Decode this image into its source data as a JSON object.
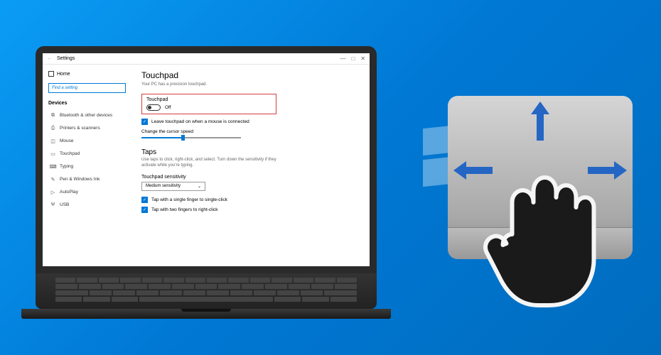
{
  "window": {
    "title": "Settings",
    "home": "Home",
    "search_placeholder": "Find a setting"
  },
  "sidebar": {
    "section": "Devices",
    "items": [
      {
        "icon": "bt",
        "label": "Bluetooth & other devices"
      },
      {
        "icon": "pr",
        "label": "Printers & scanners"
      },
      {
        "icon": "ms",
        "label": "Mouse"
      },
      {
        "icon": "tp",
        "label": "Touchpad"
      },
      {
        "icon": "ty",
        "label": "Typing"
      },
      {
        "icon": "pw",
        "label": "Pen & Windows Ink"
      },
      {
        "icon": "ap",
        "label": "AutoPlay"
      },
      {
        "icon": "us",
        "label": "USB"
      }
    ]
  },
  "main": {
    "heading": "Touchpad",
    "subtitle": "Your PC has a precision touchpad.",
    "toggle_section_label": "Touchpad",
    "toggle_value": "Off",
    "leave_on_label": "Leave touchpad on when a mouse is connected",
    "cursor_speed_label": "Change the cursor speed",
    "taps_heading": "Taps",
    "taps_desc": "Use taps to click, right-click, and select. Turn down the sensitivity if they activate while you're typing.",
    "sensitivity_label": "Touchpad sensitivity",
    "sensitivity_value": "Medium sensitivity",
    "tap_single": "Tap with a single finger to single-click",
    "tap_two": "Tap with two fingers to right-click"
  }
}
